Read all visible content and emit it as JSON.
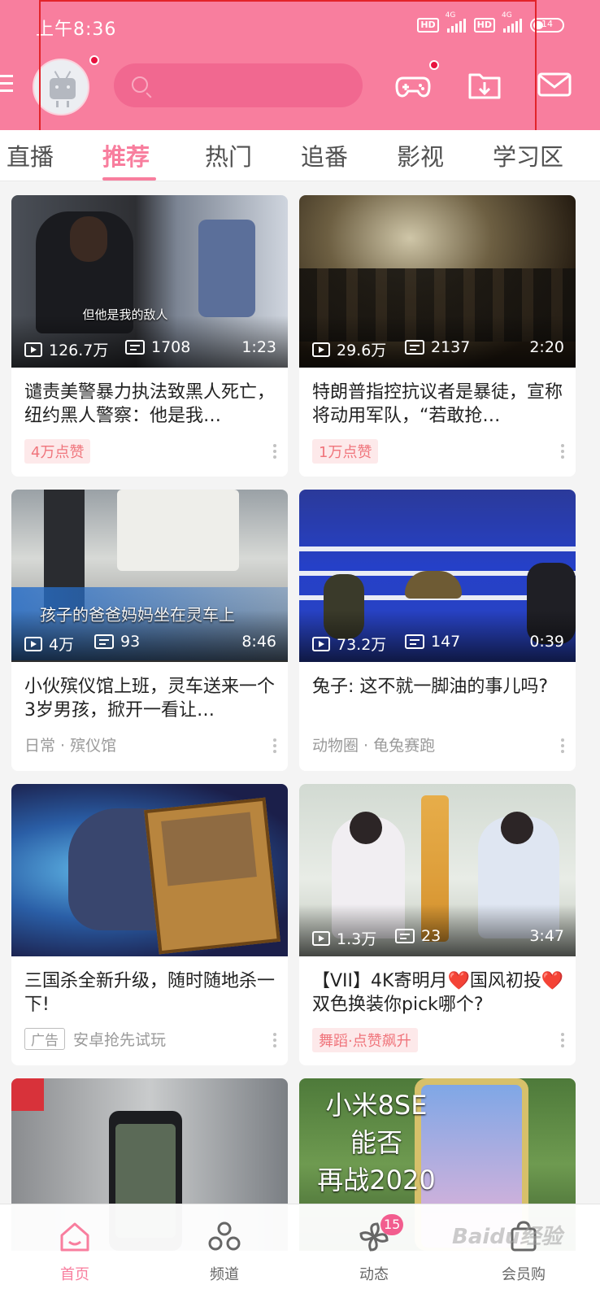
{
  "status_bar": {
    "time": "上午8:36",
    "hd1": "HD",
    "net1": "4G",
    "hd2": "HD",
    "net2": "4G",
    "battery": "14"
  },
  "header": {
    "search_placeholder": "",
    "accent_color": "#f87e9e"
  },
  "tabs": [
    {
      "label": "直播"
    },
    {
      "label": "推荐"
    },
    {
      "label": "热门"
    },
    {
      "label": "追番"
    },
    {
      "label": "影视"
    },
    {
      "label": "学习区"
    }
  ],
  "cards": [
    {
      "subtitle": "但他是我的敌人",
      "views": "126.7万",
      "danmaku": "1708",
      "duration": "1:23",
      "title": "谴责美警暴力执法致黑人死亡，纽约黑人警察：他是我…",
      "badge": "4万点赞"
    },
    {
      "subtitle": "",
      "views": "29.6万",
      "danmaku": "2137",
      "duration": "2:20",
      "title": "特朗普指控抗议者是暴徒，宣称将动用军队，“若敢抢…",
      "badge": "1万点赞"
    },
    {
      "subtitle": "孩子的爸爸妈妈坐在灵车上",
      "views": "4万",
      "danmaku": "93",
      "duration": "8:46",
      "title": "小伙殡仪馆上班，灵车送来一个3岁男孩，掀开一看让…",
      "tag": "日常 · 殡仪馆"
    },
    {
      "subtitle": "",
      "views": "73.2万",
      "danmaku": "147",
      "duration": "0:39",
      "title": "兔子: 这不就一脚油的事儿吗?",
      "tag": "动物圈 · 龟兔赛跑"
    },
    {
      "title": "三国杀全新升级，随时随地杀一下!",
      "ad_label": "广告",
      "tag": "安卓抢先试玩"
    },
    {
      "views": "1.3万",
      "danmaku": "23",
      "duration": "3:47",
      "title": "【VII】4K寄明月❤️国风初投❤️双色换装你pick哪个?",
      "badge": "舞蹈·点赞飙升"
    },
    {
      "overlay_text": ""
    },
    {
      "overlay_line1": "小米8SE",
      "overlay_line2": "能否",
      "overlay_line3": "再战2020"
    }
  ],
  "bottom_nav": [
    {
      "label": "首页",
      "icon": "home-icon"
    },
    {
      "label": "频道",
      "icon": "channel-icon"
    },
    {
      "label": "动态",
      "icon": "dynamic-icon",
      "badge": "15"
    },
    {
      "label": "会员购",
      "icon": "vip-shop-icon"
    }
  ],
  "watermark": "Baidu经验"
}
